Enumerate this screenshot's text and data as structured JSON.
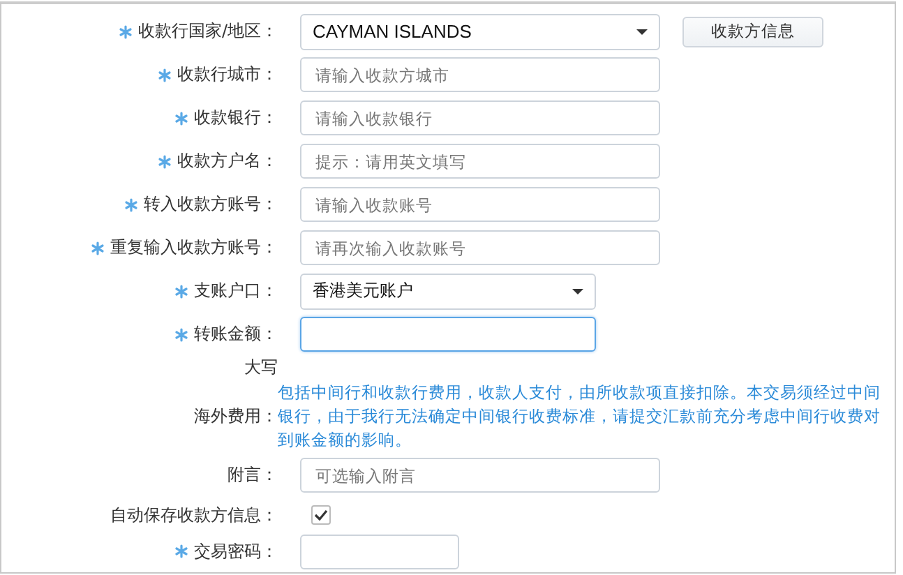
{
  "rows": [
    {
      "kind": "select",
      "label": "收款行国家/地区：",
      "required": true,
      "value": "CAYMAN ISLANDS",
      "button": "收款方信息"
    },
    {
      "kind": "input",
      "label": "收款行城市：",
      "required": true,
      "placeholder": "请输入收款方城市"
    },
    {
      "kind": "input",
      "label": "收款银行：",
      "required": true,
      "placeholder": "请输入收款银行"
    },
    {
      "kind": "input",
      "label": "收款方户名：",
      "required": true,
      "placeholder": "提示：请用英文填写"
    },
    {
      "kind": "input",
      "label": "转入收款方账号：",
      "required": true,
      "placeholder": "请输入收款账号"
    },
    {
      "kind": "input",
      "label": "重复输入收款方账号：",
      "required": true,
      "placeholder": "请再次输入收款账号"
    },
    {
      "kind": "select",
      "label": "支账户口：",
      "required": true,
      "value": "香港美元账户"
    },
    {
      "kind": "amount",
      "label": "转账金额：",
      "required": true,
      "focused": true
    },
    {
      "kind": "caption",
      "label": "大写",
      "required": false
    },
    {
      "kind": "note",
      "label": "海外费用：",
      "required": false,
      "text": "包括中间行和收款行费用，收款人支付，由所收款项直接扣除。本交易须经过中间银行，由于我行无法确定中间银行收费标准，请提交汇款前充分考虑中间行收费对到账金额的影响。"
    },
    {
      "kind": "input",
      "label": "附言：",
      "required": false,
      "placeholder": "可选输入附言"
    },
    {
      "kind": "checkbox",
      "label": "自动保存收款方信息：",
      "required": false,
      "checked": true
    },
    {
      "kind": "password",
      "label": "交易密码：",
      "required": true
    }
  ]
}
